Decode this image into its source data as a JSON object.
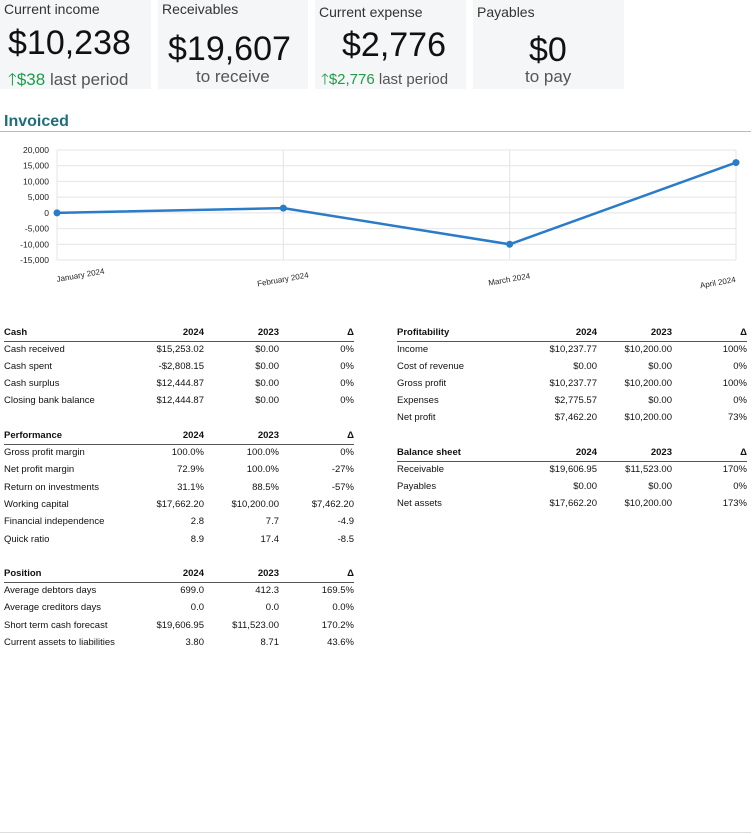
{
  "kpis": {
    "current_income": {
      "title": "Current income",
      "value": "$10,238",
      "delta": "$38",
      "suffix": "last period"
    },
    "receivables": {
      "title": "Receivables",
      "value": "$19,607",
      "sub": "to receive"
    },
    "current_expense": {
      "title": "Current expense",
      "value": "$2,776",
      "delta": "$2,776",
      "suffix": "last period"
    },
    "payables": {
      "title": "Payables",
      "value": "$0",
      "sub": "to pay"
    },
    "colors": {
      "positive": "#1f9b4a",
      "panel": "#f5f6f7"
    },
    "up_arrow_icon": "arrow-up-icon"
  },
  "invoiced": {
    "title": "Invoiced"
  },
  "chart_data": {
    "type": "line",
    "title": "Invoiced",
    "categories": [
      "January 2024",
      "February 2024",
      "March 2024",
      "April 2024"
    ],
    "values": [
      0,
      1500,
      -10000,
      16000
    ],
    "yticks": [
      "20,000",
      "15,000",
      "10,000",
      "5,000",
      "0",
      "-5,000",
      "-10,000",
      "-15,000"
    ],
    "ylim": [
      -15000,
      20000
    ],
    "grid": true,
    "color": "#2a7bc8"
  },
  "cash": {
    "headers": [
      "Cash",
      "2024",
      "2023",
      "Δ"
    ],
    "rows": [
      [
        "Cash received",
        "$15,253.02",
        "$0.00",
        "0%"
      ],
      [
        "Cash spent",
        "-$2,808.15",
        "$0.00",
        "0%"
      ],
      [
        "Cash surplus",
        "$12,444.87",
        "$0.00",
        "0%"
      ],
      [
        "Closing bank balance",
        "$12,444.87",
        "$0.00",
        "0%"
      ]
    ]
  },
  "profitability": {
    "headers": [
      "Profitability",
      "2024",
      "2023",
      "Δ"
    ],
    "rows": [
      [
        "Income",
        "$10,237.77",
        "$10,200.00",
        "100%"
      ],
      [
        "Cost of revenue",
        "$0.00",
        "$0.00",
        "0%"
      ],
      [
        "Gross profit",
        "$10,237.77",
        "$10,200.00",
        "100%"
      ],
      [
        "Expenses",
        "$2,775.57",
        "$0.00",
        "0%"
      ],
      [
        "Net profit",
        "$7,462.20",
        "$10,200.00",
        "73%"
      ]
    ]
  },
  "performance": {
    "headers": [
      "Performance",
      "2024",
      "2023",
      "Δ"
    ],
    "rows": [
      [
        "Gross profit margin",
        "100.0%",
        "100.0%",
        "0%"
      ],
      [
        "Net profit margin",
        "72.9%",
        "100.0%",
        "-27%"
      ],
      [
        "Return on investments",
        "31.1%",
        "88.5%",
        "-57%"
      ],
      [
        "Working capital",
        "$17,662.20",
        "$10,200.00",
        "$7,462.20"
      ],
      [
        "Financial independence",
        "2.8",
        "7.7",
        "-4.9"
      ],
      [
        "Quick ratio",
        "8.9",
        "17.4",
        "-8.5"
      ]
    ]
  },
  "balance_sheet": {
    "headers": [
      "Balance sheet",
      "2024",
      "2023",
      "Δ"
    ],
    "rows": [
      [
        "Receivable",
        "$19,606.95",
        "$11,523.00",
        "170%"
      ],
      [
        "Payables",
        "$0.00",
        "$0.00",
        "0%"
      ],
      [
        "Net assets",
        "$17,662.20",
        "$10,200.00",
        "173%"
      ]
    ]
  },
  "position": {
    "headers": [
      "Position",
      "2024",
      "2023",
      "Δ"
    ],
    "rows": [
      [
        "Average debtors days",
        "699.0",
        "412.3",
        "169.5%"
      ],
      [
        "Average creditors days",
        "0.0",
        "0.0",
        "0.0%"
      ],
      [
        "Short term cash forecast",
        "$19,606.95",
        "$11,523.00",
        "170.2%"
      ],
      [
        "Current assets to liabilities",
        "3.80",
        "8.71",
        "43.6%"
      ]
    ]
  }
}
